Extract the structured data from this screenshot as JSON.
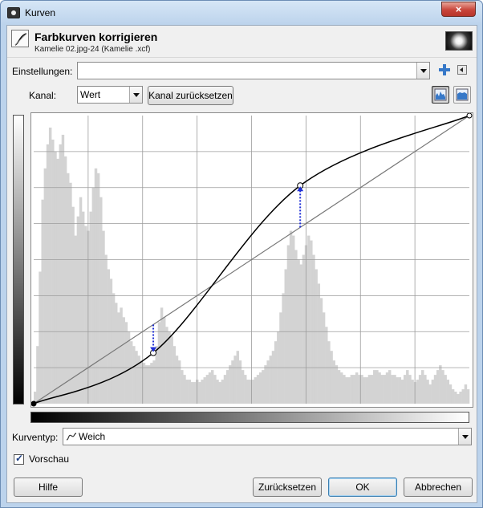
{
  "window": {
    "title": "Kurven",
    "close_icon": "×"
  },
  "header": {
    "title": "Farbkurven korrigieren",
    "subtitle": "Kamelie 02.jpg-24 (Kamelie .xcf)"
  },
  "settings": {
    "label": "Einstellungen:",
    "value": ""
  },
  "channel": {
    "label": "Kanal:",
    "value": "Wert",
    "reset_label": "Kanal zurücksetzen"
  },
  "curve_type": {
    "label": "Kurventyp:",
    "value": "Weich"
  },
  "preview": {
    "label": "Vorschau",
    "checked": true
  },
  "buttons": {
    "help": "Hilfe",
    "reset": "Zurücksetzen",
    "ok": "OK",
    "cancel": "Abbrechen"
  },
  "colors": {
    "curve": "#000000",
    "diagonal": "#777777",
    "histogram": "#d3d3d3",
    "arrow": "#1f2fd6",
    "accent_blue": "#3678c8"
  },
  "icons": [
    "app-icon",
    "curve-tool-icon",
    "plus-icon",
    "menu-arrow-icon",
    "linear-histogram-icon",
    "log-histogram-icon",
    "smooth-curve-icon",
    "check-icon"
  ],
  "chart_data": {
    "type": "line",
    "xlim": [
      0,
      255
    ],
    "ylim": [
      0,
      255
    ],
    "grid": true,
    "control_points": [
      [
        0,
        0
      ],
      [
        70,
        45
      ],
      [
        156,
        193
      ],
      [
        255,
        255
      ]
    ],
    "histogram": [
      5,
      24,
      55,
      85,
      98,
      108,
      115,
      110,
      105,
      102,
      108,
      112,
      103,
      96,
      92,
      82,
      70,
      78,
      86,
      80,
      74,
      72,
      80,
      90,
      98,
      96,
      86,
      72,
      62,
      56,
      52,
      46,
      42,
      38,
      40,
      36,
      34,
      30,
      26,
      24,
      22,
      20,
      18,
      17,
      16,
      16,
      17,
      18,
      24,
      34,
      40,
      36,
      32,
      30,
      28,
      24,
      20,
      18,
      14,
      12,
      10,
      10,
      9,
      9,
      10,
      9,
      10,
      11,
      12,
      13,
      14,
      12,
      10,
      9,
      10,
      12,
      14,
      16,
      18,
      20,
      22,
      18,
      14,
      12,
      10,
      10,
      10,
      11,
      12,
      13,
      14,
      16,
      18,
      20,
      22,
      26,
      30,
      38,
      46,
      56,
      66,
      72,
      70,
      64,
      60,
      58,
      62,
      66,
      70,
      68,
      62,
      56,
      50,
      44,
      38,
      32,
      26,
      22,
      18,
      16,
      14,
      13,
      12,
      11,
      11,
      12,
      12,
      13,
      12,
      12,
      11,
      11,
      12,
      12,
      14,
      14,
      13,
      12,
      12,
      13,
      14,
      12,
      12,
      11,
      11,
      10,
      12,
      14,
      12,
      10,
      9,
      10,
      12,
      14,
      12,
      10,
      8,
      10,
      12,
      14,
      16,
      14,
      12,
      10,
      8,
      6,
      5,
      4,
      5,
      6,
      8,
      6
    ]
  }
}
